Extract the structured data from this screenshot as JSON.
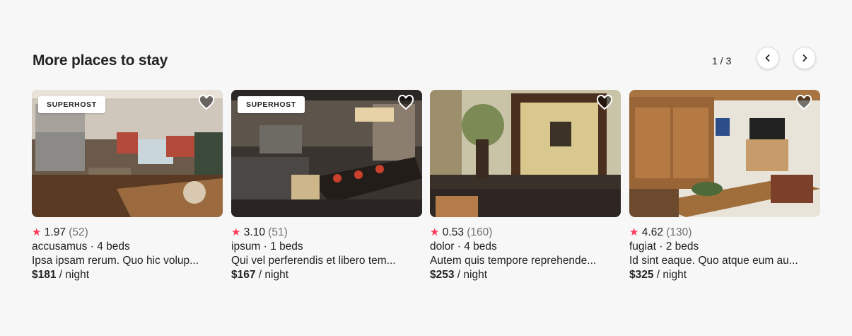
{
  "section": {
    "title": "More places to stay",
    "pager": "1 / 3",
    "prev_icon": "chevron-left-icon",
    "next_icon": "chevron-right-icon"
  },
  "colors": {
    "accent": "#ff385c",
    "muted": "#717171",
    "background": "#f7f7f7"
  },
  "listings": [
    {
      "badge": "SUPERHOST",
      "rating": "1.97",
      "reviews": "(52)",
      "name": "accusamus",
      "beds": "4 beds",
      "description": "Ipsa ipsam rerum. Quo hic volup...",
      "price": "$181",
      "unit": "/ night"
    },
    {
      "badge": "SUPERHOST",
      "rating": "3.10",
      "reviews": "(51)",
      "name": "ipsum",
      "beds": "1 beds",
      "description": "Qui vel perferendis et libero tem...",
      "price": "$167",
      "unit": "/ night"
    },
    {
      "badge": "",
      "rating": "0.53",
      "reviews": "(160)",
      "name": "dolor",
      "beds": "4 beds",
      "description": "Autem quis tempore reprehende...",
      "price": "$253",
      "unit": "/ night"
    },
    {
      "badge": "",
      "rating": "4.62",
      "reviews": "(130)",
      "name": "fugiat",
      "beds": "2 beds",
      "description": "Id sint eaque. Quo atque eum au...",
      "price": "$325",
      "unit": "/ night"
    }
  ]
}
